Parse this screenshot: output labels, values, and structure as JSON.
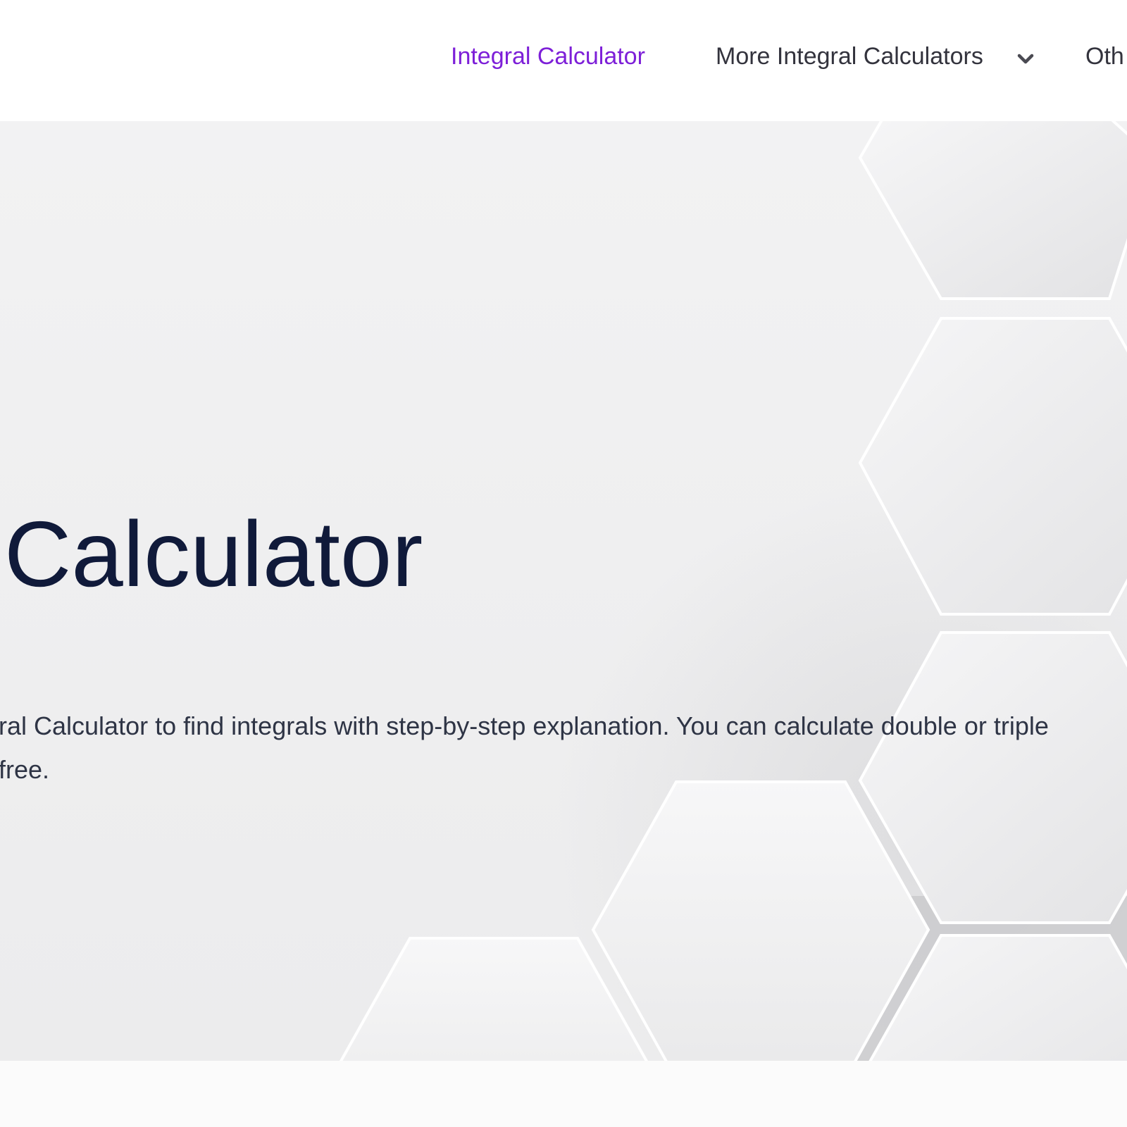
{
  "nav": {
    "items": [
      {
        "label": "Integral Calculator",
        "active": true
      },
      {
        "label": "More Integral Calculators",
        "has_dropdown": true
      },
      {
        "label": "Oth"
      }
    ]
  },
  "hero": {
    "title": "Calculator",
    "description_line1": "ral Calculator to find integrals with step-by-step explanation. You can calculate double or triple",
    "description_line2": "free."
  },
  "colors": {
    "accent": "#7d1fd8",
    "nav_text": "#33333d",
    "title": "#101a3a",
    "body_text": "#2e3445",
    "hero_background": "#efeff0"
  },
  "icons": {
    "dropdown": "chevron-down-icon"
  }
}
